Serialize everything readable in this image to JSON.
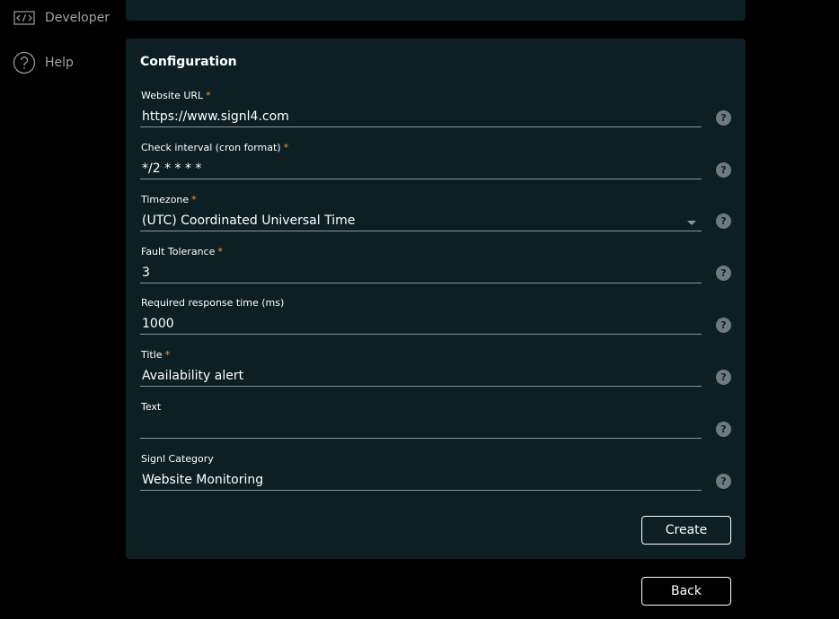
{
  "sidebar": {
    "items": [
      {
        "label": "Developer",
        "icon": "code-icon"
      },
      {
        "label": "Help",
        "icon": "question-circle-icon"
      }
    ]
  },
  "configuration": {
    "title": "Configuration",
    "required_marker": "*",
    "fields": [
      {
        "label": "Website URL",
        "required": true,
        "value": "https://www.signl4.com",
        "type": "text"
      },
      {
        "label": "Check interval (cron format)",
        "required": true,
        "value": "*/2 * * * *",
        "type": "text"
      },
      {
        "label": "Timezone",
        "required": true,
        "value": "(UTC) Coordinated Universal Time",
        "type": "select"
      },
      {
        "label": "Fault Tolerance",
        "required": true,
        "value": "3",
        "type": "text"
      },
      {
        "label": "Required response time (ms)",
        "required": false,
        "value": "1000",
        "type": "text"
      },
      {
        "label": "Title",
        "required": true,
        "value": "Availability alert",
        "type": "text"
      },
      {
        "label": "Text",
        "required": false,
        "value": "",
        "type": "text"
      },
      {
        "label": "Signl Category",
        "required": false,
        "value": "Website Monitoring",
        "type": "text"
      }
    ],
    "help_icon": "?",
    "create_label": "Create"
  },
  "back_label": "Back",
  "colors": {
    "background": "#000000",
    "panel": "#0c1f25",
    "required_accent": "#f59a23",
    "underline": "#8d9599",
    "help_icon": "#6e7a7f"
  }
}
